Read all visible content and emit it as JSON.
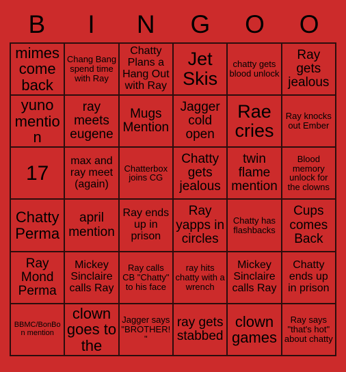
{
  "card": {
    "background_color": "#cc2b2b",
    "text_color": "#000000",
    "border_color": "#2b0d0d",
    "header": {
      "letters": [
        "B",
        "I",
        "N",
        "G",
        "O",
        "O"
      ]
    },
    "grid": {
      "columns": 6,
      "rows": 6,
      "cells": [
        {
          "text": "mimes come back",
          "size": "fs-xl"
        },
        {
          "text": "Chang Bang spend time with Ray",
          "size": "fs-sm"
        },
        {
          "text": "Chatty Plans a Hang Out with Ray",
          "size": "fs-md"
        },
        {
          "text": "Jet Skis",
          "size": "fs-xxl"
        },
        {
          "text": "chatty gets blood unlock",
          "size": "fs-sm"
        },
        {
          "text": "Ray gets jealous",
          "size": "fs-lg"
        },
        {
          "text": "yuno mention",
          "size": "fs-xl"
        },
        {
          "text": "ray meets eugene",
          "size": "fs-lg"
        },
        {
          "text": "Mugs Mention",
          "size": "fs-lg"
        },
        {
          "text": "Jagger cold open",
          "size": "fs-lg"
        },
        {
          "text": "Rae cries",
          "size": "fs-xxl"
        },
        {
          "text": "Ray knocks out Ember",
          "size": "fs-sm"
        },
        {
          "text": "17",
          "size": "fs-num"
        },
        {
          "text": "max and ray meet (again)",
          "size": "fs-md"
        },
        {
          "text": "Chatterbox joins CG",
          "size": "fs-sm"
        },
        {
          "text": "Chatty gets jealous",
          "size": "fs-lg"
        },
        {
          "text": "twin flame mention",
          "size": "fs-lg"
        },
        {
          "text": "Blood memory unlock for the clowns",
          "size": "fs-sm"
        },
        {
          "text": "Chatty Perma",
          "size": "fs-xl"
        },
        {
          "text": "april mention",
          "size": "fs-lg"
        },
        {
          "text": "Ray ends up in prison",
          "size": "fs-md"
        },
        {
          "text": "Ray yapps in circles",
          "size": "fs-lg"
        },
        {
          "text": "Chatty has flashbacks",
          "size": "fs-sm"
        },
        {
          "text": "Cups comes Back",
          "size": "fs-lg"
        },
        {
          "text": "Ray Mond Perma",
          "size": "fs-lg"
        },
        {
          "text": "Mickey Sinclaire calls Ray",
          "size": "fs-md"
        },
        {
          "text": "Ray calls CB \"Chatty\" to his face",
          "size": "fs-sm"
        },
        {
          "text": "ray hits chatty with a wrench",
          "size": "fs-sm"
        },
        {
          "text": "Mickey Sinclaire calls Ray",
          "size": "fs-md"
        },
        {
          "text": "Chatty ends up in prison",
          "size": "fs-md"
        },
        {
          "text": "BBMC/BonBon mention",
          "size": "fs-xs"
        },
        {
          "text": "a clown goes to the ICU",
          "size": "fs-xl"
        },
        {
          "text": "Jagger says \"BROTHER!\"",
          "size": "fs-sm"
        },
        {
          "text": "ray gets stabbed",
          "size": "fs-lg"
        },
        {
          "text": "clown games",
          "size": "fs-xl"
        },
        {
          "text": "Ray says \"that's hot\" about chatty",
          "size": "fs-sm"
        }
      ]
    }
  }
}
